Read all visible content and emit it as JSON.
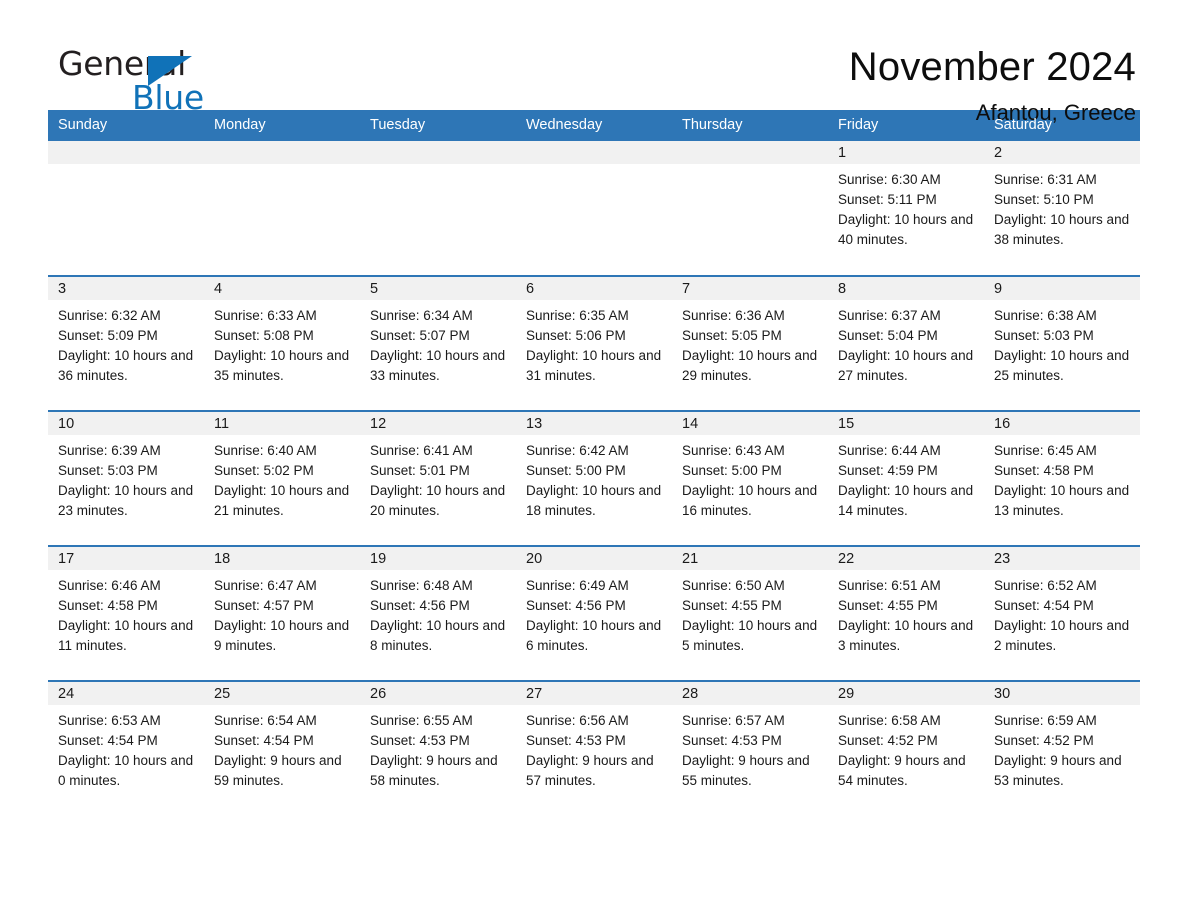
{
  "logo": {
    "word_general": "General",
    "word_blue": "Blue",
    "triangle_color": "#1072b8"
  },
  "header": {
    "title": "November 2024",
    "subtitle": "Afantou, Greece",
    "accent_color": "#2e76b6",
    "daynum_band_color": "#f1f1f1"
  },
  "weekday_headers": [
    "Sunday",
    "Monday",
    "Tuesday",
    "Wednesday",
    "Thursday",
    "Friday",
    "Saturday"
  ],
  "weeks": [
    [
      {
        "day": "",
        "sunrise": "",
        "sunset": "",
        "daylight": ""
      },
      {
        "day": "",
        "sunrise": "",
        "sunset": "",
        "daylight": ""
      },
      {
        "day": "",
        "sunrise": "",
        "sunset": "",
        "daylight": ""
      },
      {
        "day": "",
        "sunrise": "",
        "sunset": "",
        "daylight": ""
      },
      {
        "day": "",
        "sunrise": "",
        "sunset": "",
        "daylight": ""
      },
      {
        "day": "1",
        "sunrise": "Sunrise: 6:30 AM",
        "sunset": "Sunset: 5:11 PM",
        "daylight": "Daylight: 10 hours and 40 minutes."
      },
      {
        "day": "2",
        "sunrise": "Sunrise: 6:31 AM",
        "sunset": "Sunset: 5:10 PM",
        "daylight": "Daylight: 10 hours and 38 minutes."
      }
    ],
    [
      {
        "day": "3",
        "sunrise": "Sunrise: 6:32 AM",
        "sunset": "Sunset: 5:09 PM",
        "daylight": "Daylight: 10 hours and 36 minutes."
      },
      {
        "day": "4",
        "sunrise": "Sunrise: 6:33 AM",
        "sunset": "Sunset: 5:08 PM",
        "daylight": "Daylight: 10 hours and 35 minutes."
      },
      {
        "day": "5",
        "sunrise": "Sunrise: 6:34 AM",
        "sunset": "Sunset: 5:07 PM",
        "daylight": "Daylight: 10 hours and 33 minutes."
      },
      {
        "day": "6",
        "sunrise": "Sunrise: 6:35 AM",
        "sunset": "Sunset: 5:06 PM",
        "daylight": "Daylight: 10 hours and 31 minutes."
      },
      {
        "day": "7",
        "sunrise": "Sunrise: 6:36 AM",
        "sunset": "Sunset: 5:05 PM",
        "daylight": "Daylight: 10 hours and 29 minutes."
      },
      {
        "day": "8",
        "sunrise": "Sunrise: 6:37 AM",
        "sunset": "Sunset: 5:04 PM",
        "daylight": "Daylight: 10 hours and 27 minutes."
      },
      {
        "day": "9",
        "sunrise": "Sunrise: 6:38 AM",
        "sunset": "Sunset: 5:03 PM",
        "daylight": "Daylight: 10 hours and 25 minutes."
      }
    ],
    [
      {
        "day": "10",
        "sunrise": "Sunrise: 6:39 AM",
        "sunset": "Sunset: 5:03 PM",
        "daylight": "Daylight: 10 hours and 23 minutes."
      },
      {
        "day": "11",
        "sunrise": "Sunrise: 6:40 AM",
        "sunset": "Sunset: 5:02 PM",
        "daylight": "Daylight: 10 hours and 21 minutes."
      },
      {
        "day": "12",
        "sunrise": "Sunrise: 6:41 AM",
        "sunset": "Sunset: 5:01 PM",
        "daylight": "Daylight: 10 hours and 20 minutes."
      },
      {
        "day": "13",
        "sunrise": "Sunrise: 6:42 AM",
        "sunset": "Sunset: 5:00 PM",
        "daylight": "Daylight: 10 hours and 18 minutes."
      },
      {
        "day": "14",
        "sunrise": "Sunrise: 6:43 AM",
        "sunset": "Sunset: 5:00 PM",
        "daylight": "Daylight: 10 hours and 16 minutes."
      },
      {
        "day": "15",
        "sunrise": "Sunrise: 6:44 AM",
        "sunset": "Sunset: 4:59 PM",
        "daylight": "Daylight: 10 hours and 14 minutes."
      },
      {
        "day": "16",
        "sunrise": "Sunrise: 6:45 AM",
        "sunset": "Sunset: 4:58 PM",
        "daylight": "Daylight: 10 hours and 13 minutes."
      }
    ],
    [
      {
        "day": "17",
        "sunrise": "Sunrise: 6:46 AM",
        "sunset": "Sunset: 4:58 PM",
        "daylight": "Daylight: 10 hours and 11 minutes."
      },
      {
        "day": "18",
        "sunrise": "Sunrise: 6:47 AM",
        "sunset": "Sunset: 4:57 PM",
        "daylight": "Daylight: 10 hours and 9 minutes."
      },
      {
        "day": "19",
        "sunrise": "Sunrise: 6:48 AM",
        "sunset": "Sunset: 4:56 PM",
        "daylight": "Daylight: 10 hours and 8 minutes."
      },
      {
        "day": "20",
        "sunrise": "Sunrise: 6:49 AM",
        "sunset": "Sunset: 4:56 PM",
        "daylight": "Daylight: 10 hours and 6 minutes."
      },
      {
        "day": "21",
        "sunrise": "Sunrise: 6:50 AM",
        "sunset": "Sunset: 4:55 PM",
        "daylight": "Daylight: 10 hours and 5 minutes."
      },
      {
        "day": "22",
        "sunrise": "Sunrise: 6:51 AM",
        "sunset": "Sunset: 4:55 PM",
        "daylight": "Daylight: 10 hours and 3 minutes."
      },
      {
        "day": "23",
        "sunrise": "Sunrise: 6:52 AM",
        "sunset": "Sunset: 4:54 PM",
        "daylight": "Daylight: 10 hours and 2 minutes."
      }
    ],
    [
      {
        "day": "24",
        "sunrise": "Sunrise: 6:53 AM",
        "sunset": "Sunset: 4:54 PM",
        "daylight": "Daylight: 10 hours and 0 minutes."
      },
      {
        "day": "25",
        "sunrise": "Sunrise: 6:54 AM",
        "sunset": "Sunset: 4:54 PM",
        "daylight": "Daylight: 9 hours and 59 minutes."
      },
      {
        "day": "26",
        "sunrise": "Sunrise: 6:55 AM",
        "sunset": "Sunset: 4:53 PM",
        "daylight": "Daylight: 9 hours and 58 minutes."
      },
      {
        "day": "27",
        "sunrise": "Sunrise: 6:56 AM",
        "sunset": "Sunset: 4:53 PM",
        "daylight": "Daylight: 9 hours and 57 minutes."
      },
      {
        "day": "28",
        "sunrise": "Sunrise: 6:57 AM",
        "sunset": "Sunset: 4:53 PM",
        "daylight": "Daylight: 9 hours and 55 minutes."
      },
      {
        "day": "29",
        "sunrise": "Sunrise: 6:58 AM",
        "sunset": "Sunset: 4:52 PM",
        "daylight": "Daylight: 9 hours and 54 minutes."
      },
      {
        "day": "30",
        "sunrise": "Sunrise: 6:59 AM",
        "sunset": "Sunset: 4:52 PM",
        "daylight": "Daylight: 9 hours and 53 minutes."
      }
    ]
  ]
}
